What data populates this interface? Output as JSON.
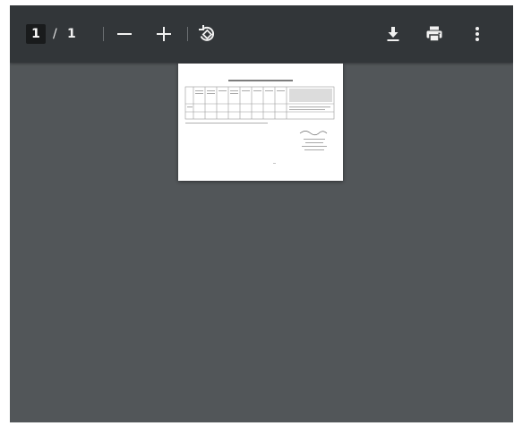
{
  "toolbar": {
    "current_page": "1",
    "page_separator": "/",
    "total_pages": "1"
  },
  "icons": {
    "zoom_out": "minus-icon",
    "zoom_in": "plus-icon",
    "rotate": "rotate-icon",
    "download": "download-icon",
    "print": "print-icon",
    "more": "more-vertical-icon"
  },
  "colors": {
    "toolbar_bg": "#323639",
    "viewer_bg": "#525659",
    "page_bg": "#ffffff",
    "icon": "#f1f1f1"
  }
}
